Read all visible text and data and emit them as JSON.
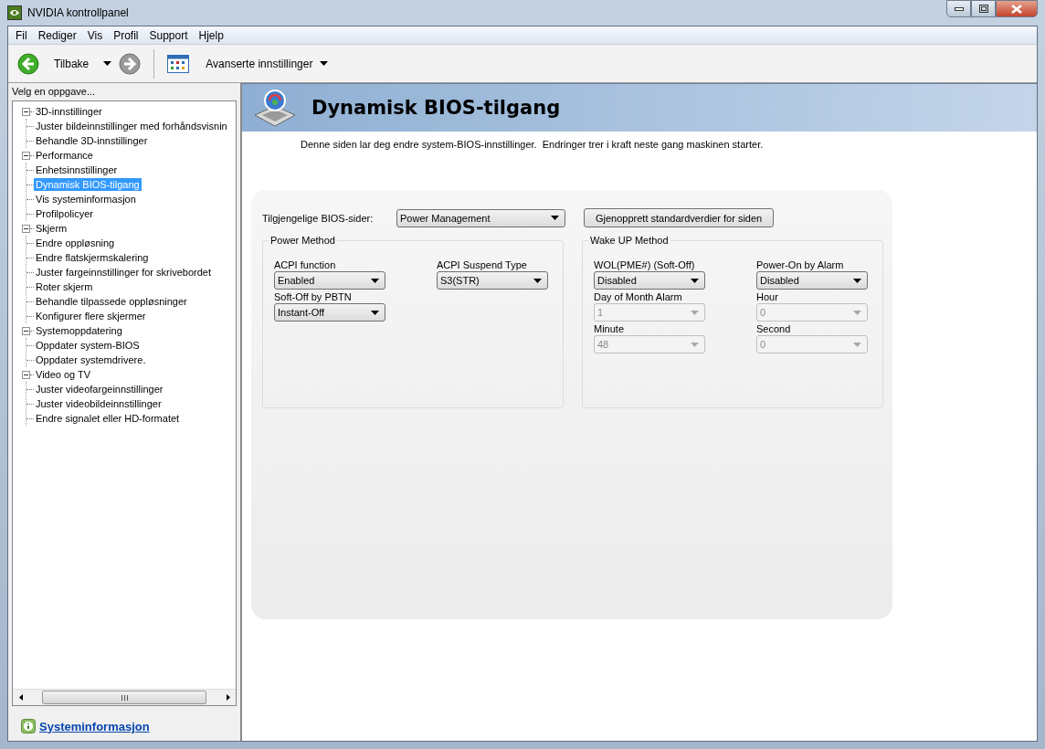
{
  "window": {
    "title": "NVIDIA kontrollpanel"
  },
  "menu": [
    "Fil",
    "Rediger",
    "Vis",
    "Profil",
    "Support",
    "Hjelp"
  ],
  "toolbar": {
    "back_label": "Tilbake",
    "view_label": "Avanserte innstillinger"
  },
  "sidebar": {
    "header": "Velg en oppgave...",
    "tree": [
      {
        "label": "3D-innstillinger",
        "expanded": true,
        "selected": false,
        "children": [
          {
            "label": "Juster bildeinnstillinger med forhåndsvisnin",
            "selected": false
          },
          {
            "label": "Behandle 3D-innstillinger",
            "selected": false
          }
        ]
      },
      {
        "label": "Performance",
        "expanded": true,
        "selected": false,
        "children": [
          {
            "label": "Enhetsinnstillinger",
            "selected": false
          },
          {
            "label": "Dynamisk BIOS-tilgang",
            "selected": true
          },
          {
            "label": "Vis systeminformasjon",
            "selected": false
          },
          {
            "label": "Profilpolicyer",
            "selected": false
          }
        ]
      },
      {
        "label": "Skjerm",
        "expanded": true,
        "selected": false,
        "children": [
          {
            "label": "Endre oppløsning",
            "selected": false
          },
          {
            "label": "Endre flatskjermskalering",
            "selected": false
          },
          {
            "label": "Juster fargeinnstillinger for skrivebordet",
            "selected": false
          },
          {
            "label": "Roter skjerm",
            "selected": false
          },
          {
            "label": "Behandle tilpassede oppløsninger",
            "selected": false
          },
          {
            "label": "Konfigurer flere skjermer",
            "selected": false
          }
        ]
      },
      {
        "label": "Systemoppdatering",
        "expanded": true,
        "selected": false,
        "children": [
          {
            "label": "Oppdater system-BIOS",
            "selected": false
          },
          {
            "label": "Oppdater systemdrivere.",
            "selected": false
          }
        ]
      },
      {
        "label": "Video og TV",
        "expanded": true,
        "selected": false,
        "children": [
          {
            "label": "Juster videofargeinnstillinger",
            "selected": false
          },
          {
            "label": "Juster videobildeinnstillinger",
            "selected": false
          },
          {
            "label": "Endre signalet eller HD-formatet",
            "selected": false
          }
        ]
      }
    ],
    "footer_link": "Systeminformasjon"
  },
  "page": {
    "title": "Dynamisk BIOS-tilgang",
    "description": "Denne siden lar deg endre system-BIOS-innstillinger.  Endringer trer i kraft neste gang maskinen starter.",
    "bios_pages_label": "Tilgjengelige BIOS-sider:",
    "bios_pages_value": "Power Management",
    "restore_button": "Gjenopprett standardverdier for siden",
    "groups": [
      {
        "title": "Power Method",
        "fields": [
          {
            "label": "ACPI function",
            "value": "Enabled",
            "disabled": false
          },
          {
            "label": "ACPI Suspend Type",
            "value": "S3(STR)",
            "disabled": false
          },
          {
            "label": "Soft-Off by PBTN",
            "value": "Instant-Off",
            "disabled": false
          }
        ]
      },
      {
        "title": "Wake UP Method",
        "fields": [
          {
            "label": "WOL(PME#) (Soft-Off)",
            "value": "Disabled",
            "disabled": false
          },
          {
            "label": "Power-On by Alarm",
            "value": "Disabled",
            "disabled": false
          },
          {
            "label": "Day of Month Alarm",
            "value": "1",
            "disabled": true
          },
          {
            "label": "Hour",
            "value": "0",
            "disabled": true
          },
          {
            "label": "Minute",
            "value": "48",
            "disabled": true
          },
          {
            "label": "Second",
            "value": "0",
            "disabled": true
          }
        ]
      }
    ]
  }
}
